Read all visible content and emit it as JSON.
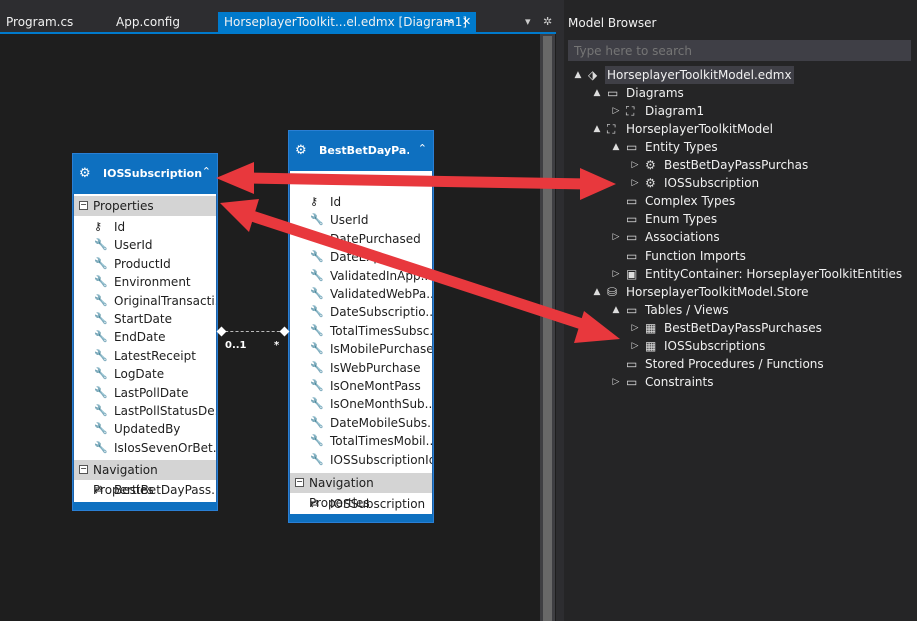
{
  "tabs": {
    "program": "Program.cs",
    "appconfig": "App.config",
    "active": "HorseplayerToolkit...el.edmx [Diagram1]",
    "pin_icon": "pin-icon",
    "close_icon": "close-icon"
  },
  "toolbar": {
    "dropdown_icon": "chevron-down-icon",
    "settings_icon": "gear-icon"
  },
  "entities": {
    "ios": {
      "name": "IOSSubscription",
      "properties_label": "Properties",
      "props": [
        "Id",
        "UserId",
        "ProductId",
        "Environment",
        "OriginalTransacti...",
        "StartDate",
        "EndDate",
        "LatestReceipt",
        "LogDate",
        "LastPollDate",
        "LastPollStatusDe...",
        "UpdatedBy",
        "IsIosSevenOrBet..."
      ],
      "nav_label": "Navigation Properties",
      "nav": [
        "BestBetDayPass..."
      ]
    },
    "best": {
      "name": "BestBetDayPa...",
      "props_partial_top": "",
      "props": [
        "Id",
        "UserId",
        "DatePurchased",
        "DateExp...",
        "ValidatedInApp...",
        "ValidatedWebPa...",
        "DateSubscriptio...",
        "TotalTimesSubsc...",
        "IsMobilePurchase",
        "IsWebPurchase",
        "IsOneMontPass",
        "IsOneMonthSub...",
        "DateMobileSubs...",
        "TotalTimesMobil...",
        "IOSSubscriptionId"
      ],
      "nav_label": "Navigation Properties",
      "nav": [
        "IOSSubscription"
      ]
    }
  },
  "association": {
    "left_mult": "0..1",
    "right_mult": "*"
  },
  "model_browser": {
    "title": "Model Browser",
    "search_placeholder": "Type here to search",
    "tree": [
      {
        "label": "HorseplayerToolkitModel.edmx",
        "depth": 0,
        "arrow": "▲",
        "icon": "edmx-icon",
        "selected": true
      },
      {
        "label": "Diagrams",
        "depth": 1,
        "arrow": "▲",
        "icon": "folder-icon"
      },
      {
        "label": "Diagram1",
        "depth": 2,
        "arrow": "▷",
        "icon": "diagram-icon"
      },
      {
        "label": "HorseplayerToolkitModel",
        "depth": 1,
        "arrow": "▲",
        "icon": "model-icon"
      },
      {
        "label": "Entity Types",
        "depth": 2,
        "arrow": "▲",
        "icon": "folder-icon"
      },
      {
        "label": "BestBetDayPassPurchas",
        "depth": 3,
        "arrow": "▷",
        "icon": "entity-icon"
      },
      {
        "label": "IOSSubscription",
        "depth": 3,
        "arrow": "▷",
        "icon": "entity-icon"
      },
      {
        "label": "Complex Types",
        "depth": 2,
        "arrow": "",
        "icon": "folder-icon"
      },
      {
        "label": "Enum Types",
        "depth": 2,
        "arrow": "",
        "icon": "folder-icon"
      },
      {
        "label": "Associations",
        "depth": 2,
        "arrow": "▷",
        "icon": "folder-icon"
      },
      {
        "label": "Function Imports",
        "depth": 2,
        "arrow": "",
        "icon": "folder-icon"
      },
      {
        "label": "EntityContainer: HorseplayerToolkitEntities",
        "depth": 2,
        "arrow": "▷",
        "icon": "container-icon"
      },
      {
        "label": "HorseplayerToolkitModel.Store",
        "depth": 1,
        "arrow": "▲",
        "icon": "database-icon"
      },
      {
        "label": "Tables / Views",
        "depth": 2,
        "arrow": "▲",
        "icon": "folder-icon"
      },
      {
        "label": "BestBetDayPassPurchases",
        "depth": 3,
        "arrow": "▷",
        "icon": "table-icon"
      },
      {
        "label": "IOSSubscriptions",
        "depth": 3,
        "arrow": "▷",
        "icon": "table-icon"
      },
      {
        "label": "Stored Procedures / Functions",
        "depth": 2,
        "arrow": "",
        "icon": "folder-icon"
      },
      {
        "label": "Constraints",
        "depth": 2,
        "arrow": "▷",
        "icon": "folder-icon"
      }
    ]
  },
  "colors": {
    "accent": "#007acc",
    "arrow": "#e8383d",
    "entity_header": "#0e70c0"
  }
}
